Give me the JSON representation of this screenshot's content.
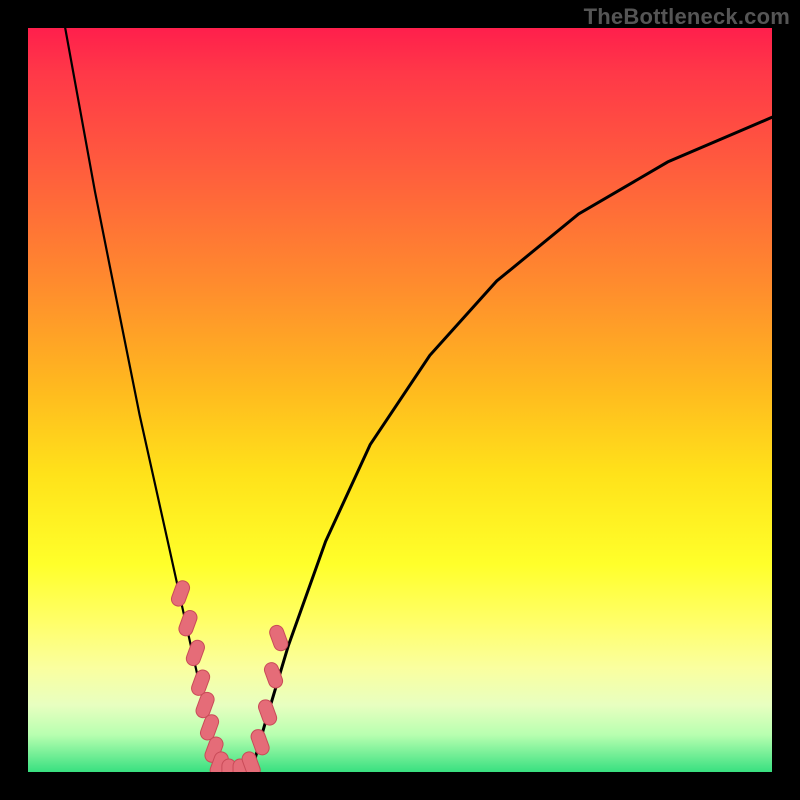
{
  "watermark": "TheBottleneck.com",
  "chart_data": {
    "type": "line",
    "title": "",
    "xlabel": "",
    "ylabel": "",
    "xlim": [
      0,
      100
    ],
    "ylim": [
      0,
      100
    ],
    "series": [
      {
        "name": "left-curve",
        "x": [
          5,
          7,
          9,
          11,
          13,
          15,
          17,
          19,
          21,
          23,
          24.5,
          26
        ],
        "y": [
          100,
          89,
          78,
          68,
          58,
          48,
          39,
          30,
          21,
          12,
          5,
          0
        ]
      },
      {
        "name": "right-curve",
        "x": [
          30,
          32,
          35,
          40,
          46,
          54,
          63,
          74,
          86,
          100
        ],
        "y": [
          0,
          7,
          17,
          31,
          44,
          56,
          66,
          75,
          82,
          88
        ]
      },
      {
        "name": "markers",
        "x": [
          20.5,
          21.5,
          22.5,
          23.2,
          23.8,
          24.4,
          25.0,
          25.7,
          27.0,
          28.5,
          30.0,
          31.2,
          32.2,
          33.0,
          33.7
        ],
        "y": [
          24,
          20,
          16,
          12,
          9,
          6,
          3,
          1,
          0,
          0,
          1,
          4,
          8,
          13,
          18
        ]
      }
    ],
    "colors": {
      "curve": "#000000",
      "marker_fill": "#e56c78",
      "marker_stroke": "#c94b58"
    }
  }
}
